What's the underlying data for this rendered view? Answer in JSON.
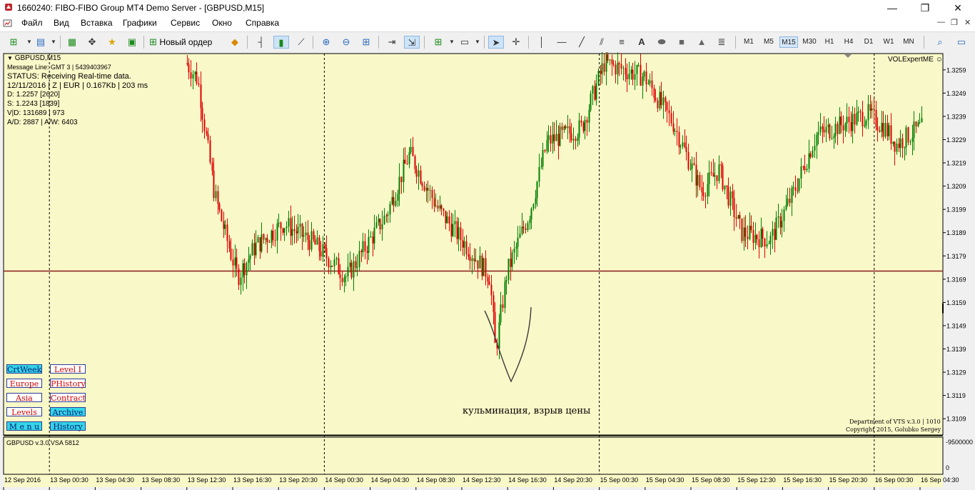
{
  "window": {
    "title": "1660240: FIBO-FIBO Group MT4 Demo Server - [GBPUSD,M15]",
    "minimize": "—",
    "maximize": "❐",
    "close": "✕"
  },
  "menu": {
    "items": [
      "Файл",
      "Вид",
      "Вставка",
      "Графики",
      "Сервис",
      "Окно",
      "Справка"
    ],
    "controls": [
      "—",
      "❐",
      "✕"
    ]
  },
  "toolbar": {
    "new_order_label": "Новый ордер",
    "timeframes": [
      "M1",
      "M5",
      "M15",
      "M30",
      "H1",
      "H4",
      "D1",
      "W1",
      "MN"
    ],
    "active_timeframe": "M15"
  },
  "chart": {
    "symbol_header": "GBPUSD,M15",
    "info_lines": [
      "Message Line: GMT 3 | 5439403967",
      "STATUS:  Receiving Real-time data.",
      "12/11/2016 | Z | EUR | 0.167Kb | 203 ms",
      "D: 1.2257 [2620]",
      "S: 1.2243 [1839]",
      "V|D: 131689 | 973",
      "A/D: 2887 | A/W: 6403"
    ],
    "expert_name": "VOLExpertME",
    "annotation": "кульминация, взрыв цены",
    "footer_lines": [
      "Department of VTS  v.3.0 | 1010",
      "Copyright 2015, Golubko Sergey"
    ],
    "buttons": [
      {
        "label": "CrtWeek",
        "style": "cyan"
      },
      {
        "label": "Level I",
        "style": "white"
      },
      {
        "label": "Europe",
        "style": "white"
      },
      {
        "label": "PHistory",
        "style": "white"
      },
      {
        "label": "Asia",
        "style": "white"
      },
      {
        "label": "Contract",
        "style": "white"
      },
      {
        "label": "Levels",
        "style": "white"
      },
      {
        "label": "Archive",
        "style": "cyan"
      },
      {
        "label": "M e n u",
        "style": "cyan"
      },
      {
        "label": "History",
        "style": "cyan"
      }
    ],
    "price_ticks": [
      "1.3259",
      "1.3249",
      "1.3239",
      "1.3229",
      "1.3219",
      "1.3209",
      "1.3199",
      "1.3189",
      "1.3179",
      "1.3169",
      "1.3159",
      "1.3149",
      "1.3139",
      "1.3129",
      "1.3119",
      "1.3109"
    ],
    "horizontal_level": 1.31725,
    "time_ticks": [
      "12 Sep 2016",
      "13 Sep 00:30",
      "13 Sep 04:30",
      "13 Sep 08:30",
      "13 Sep 12:30",
      "13 Sep 16:30",
      "13 Sep 20:30",
      "14 Sep 00:30",
      "14 Sep 04:30",
      "14 Sep 08:30",
      "14 Sep 12:30",
      "14 Sep 16:30",
      "14 Sep 20:30",
      "15 Sep 00:30",
      "15 Sep 04:30",
      "15 Sep 08:30",
      "15 Sep 12:30",
      "15 Sep 16:30",
      "15 Sep 20:30",
      "16 Sep 00:30",
      "16 Sep 04:30"
    ],
    "colors": {
      "background": "#f9f8c8",
      "bull": "#008000",
      "bear": "#e00000",
      "level": "#8b1a1a",
      "grid": "#000000"
    }
  },
  "indicator": {
    "label": "GBPUSD  v.3.0 VSA  5812",
    "max_label": "-9500000",
    "zero_label": "0"
  },
  "chart_data": {
    "type": "candlestick",
    "symbol": "GBPUSD",
    "timeframe": "M15",
    "ylim": [
      1.3102,
      1.3266
    ],
    "day_separators": [
      "13 Sep 00:30",
      "14 Sep 00:30",
      "15 Sep 00:30",
      "16 Sep 00:30"
    ],
    "path_keypoints": [
      {
        "time": "13 Sep 12:30",
        "price": 1.3262
      },
      {
        "time": "13 Sep 13:30",
        "price": 1.3255
      },
      {
        "time": "13 Sep 15:00",
        "price": 1.3205
      },
      {
        "time": "13 Sep 16:00",
        "price": 1.3187
      },
      {
        "time": "13 Sep 17:00",
        "price": 1.317
      },
      {
        "time": "13 Sep 18:30",
        "price": 1.3183
      },
      {
        "time": "13 Sep 21:00",
        "price": 1.3193
      },
      {
        "time": "13 Sep 23:30",
        "price": 1.3185
      },
      {
        "time": "14 Sep 02:30",
        "price": 1.317
      },
      {
        "time": "14 Sep 06:00",
        "price": 1.3197
      },
      {
        "time": "14 Sep 08:00",
        "price": 1.3223
      },
      {
        "time": "14 Sep 10:30",
        "price": 1.3199
      },
      {
        "time": "14 Sep 13:30",
        "price": 1.318
      },
      {
        "time": "14 Sep 15:00",
        "price": 1.317
      },
      {
        "time": "14 Sep 15:30",
        "price": 1.3138
      },
      {
        "time": "14 Sep 16:30",
        "price": 1.3172
      },
      {
        "time": "14 Sep 18:30",
        "price": 1.3198
      },
      {
        "time": "14 Sep 20:00",
        "price": 1.3228
      },
      {
        "time": "14 Sep 23:00",
        "price": 1.3234
      },
      {
        "time": "15 Sep 01:00",
        "price": 1.3262
      },
      {
        "time": "15 Sep 04:30",
        "price": 1.3256
      },
      {
        "time": "15 Sep 07:00",
        "price": 1.3236
      },
      {
        "time": "15 Sep 09:30",
        "price": 1.3207
      },
      {
        "time": "15 Sep 11:00",
        "price": 1.3216
      },
      {
        "time": "15 Sep 13:00",
        "price": 1.3189
      },
      {
        "time": "15 Sep 15:30",
        "price": 1.3186
      },
      {
        "time": "15 Sep 17:30",
        "price": 1.3206
      },
      {
        "time": "15 Sep 19:30",
        "price": 1.3231
      },
      {
        "time": "16 Sep 00:00",
        "price": 1.324
      },
      {
        "time": "16 Sep 01:30",
        "price": 1.3234
      },
      {
        "time": "16 Sep 02:30",
        "price": 1.3227
      },
      {
        "time": "16 Sep 04:30",
        "price": 1.3234
      }
    ]
  }
}
